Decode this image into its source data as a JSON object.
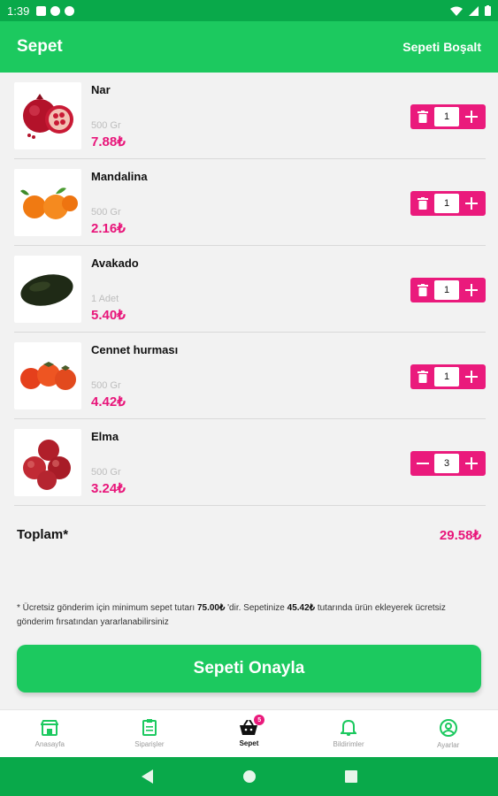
{
  "status_bar": {
    "time": "1:39"
  },
  "app_bar": {
    "title": "Sepet",
    "empty_cart_label": "Sepeti Boşalt"
  },
  "cart": {
    "items": [
      {
        "name": "Nar",
        "unit": "500 Gr",
        "price": "7.88₺",
        "quantity": "1",
        "image": "pomegranate"
      },
      {
        "name": "Mandalina",
        "unit": "500 Gr",
        "price": "2.16₺",
        "quantity": "1",
        "image": "tangerine"
      },
      {
        "name": "Avakado",
        "unit": "1 Adet",
        "price": "5.40₺",
        "quantity": "1",
        "image": "avocado"
      },
      {
        "name": "Cennet hurması",
        "unit": "500 Gr",
        "price": "4.42₺",
        "quantity": "1",
        "image": "persimmon"
      },
      {
        "name": "Elma",
        "unit": "500 Gr",
        "price": "3.24₺",
        "quantity": "3",
        "image": "apple"
      }
    ]
  },
  "total": {
    "label": "Toplam*",
    "value": "29.58₺"
  },
  "note": {
    "part1": "* Ücretsiz gönderim için minimum sepet tutarı ",
    "min_amount": "75.00₺",
    "part2": " 'dir. Sepetinize ",
    "remaining_amount": "45.42₺",
    "part3": " tutarında ürün ekleyerek ücretsiz gönderim fırsatından yararlanabilirsiniz"
  },
  "confirm_button": "Sepeti Onayla",
  "bottom_nav": {
    "items": [
      {
        "label": "Anasayfa",
        "icon": "store-icon"
      },
      {
        "label": "Siparişler",
        "icon": "clipboard-icon"
      },
      {
        "label": "Sepet",
        "icon": "basket-icon",
        "badge": "5",
        "active": true
      },
      {
        "label": "Bildirimler",
        "icon": "bell-icon"
      },
      {
        "label": "Ayarlar",
        "icon": "profile-icon"
      }
    ]
  },
  "colors": {
    "primary_green": "#1cc95f",
    "dark_green": "#09a94a",
    "accent_pink": "#ea1a7c",
    "price_pink": "#e8157a"
  }
}
